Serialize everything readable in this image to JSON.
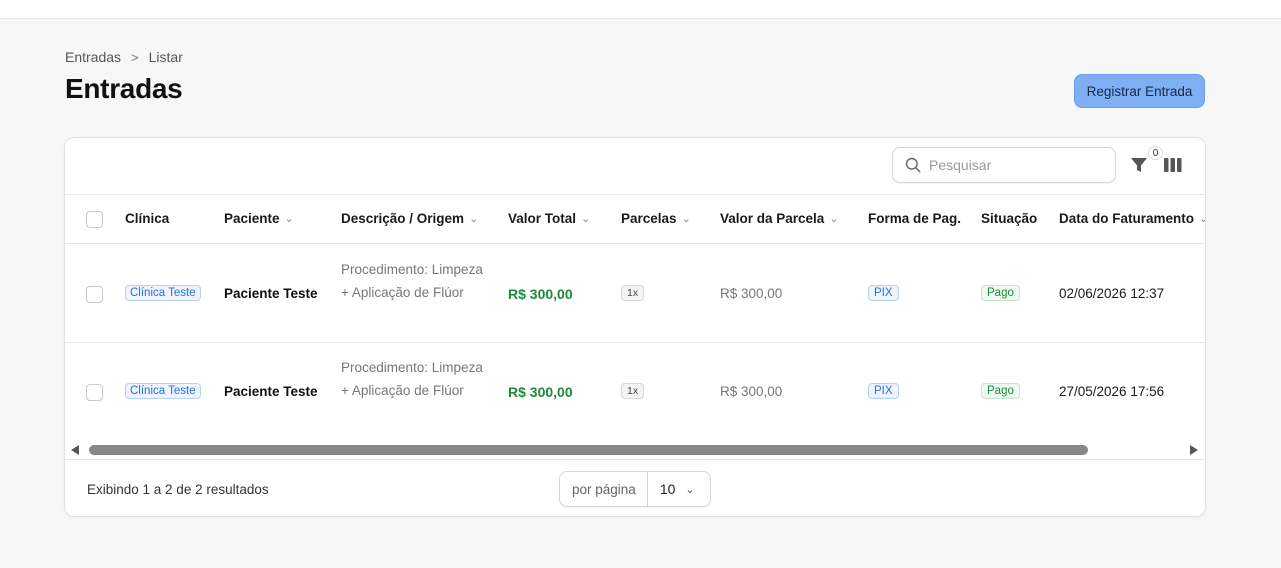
{
  "breadcrumb": {
    "items": [
      "Entradas",
      "Listar"
    ],
    "separator": ">"
  },
  "page": {
    "title": "Entradas",
    "primary_action": "Registrar Entrada"
  },
  "toolbar": {
    "search_placeholder": "Pesquisar",
    "filter_count": "0"
  },
  "table": {
    "columns": [
      "Clínica",
      "Paciente",
      "Descrição / Origem",
      "Valor Total",
      "Parcelas",
      "Valor da Parcela",
      "Forma de Pag.",
      "Situação",
      "Data do Faturamento"
    ],
    "rows": [
      {
        "clinic": "Clínica Teste",
        "patient": "Paciente Teste",
        "description": "Procedimento: Limpeza + Aplicação de Flúor",
        "total": "R$ 300,00",
        "installments": "1x",
        "installment_value": "R$ 300,00",
        "payment": "PIX",
        "status": "Pago",
        "date": "02/06/2026 12:37"
      },
      {
        "clinic": "Clínica Teste",
        "patient": "Paciente Teste",
        "description": "Procedimento: Limpeza + Aplicação de Flúor",
        "total": "R$ 300,00",
        "installments": "1x",
        "installment_value": "R$ 300,00",
        "payment": "PIX",
        "status": "Pago",
        "date": "27/05/2026 17:56"
      }
    ]
  },
  "footer": {
    "results_text": "Exibindo 1 a 2 de 2 resultados",
    "per_page_label": "por página",
    "per_page_value": "10"
  },
  "colors": {
    "primary_button": "#7eaff5",
    "total_green": "#1c8a3b",
    "chip_blue": "#2d6fd1"
  }
}
